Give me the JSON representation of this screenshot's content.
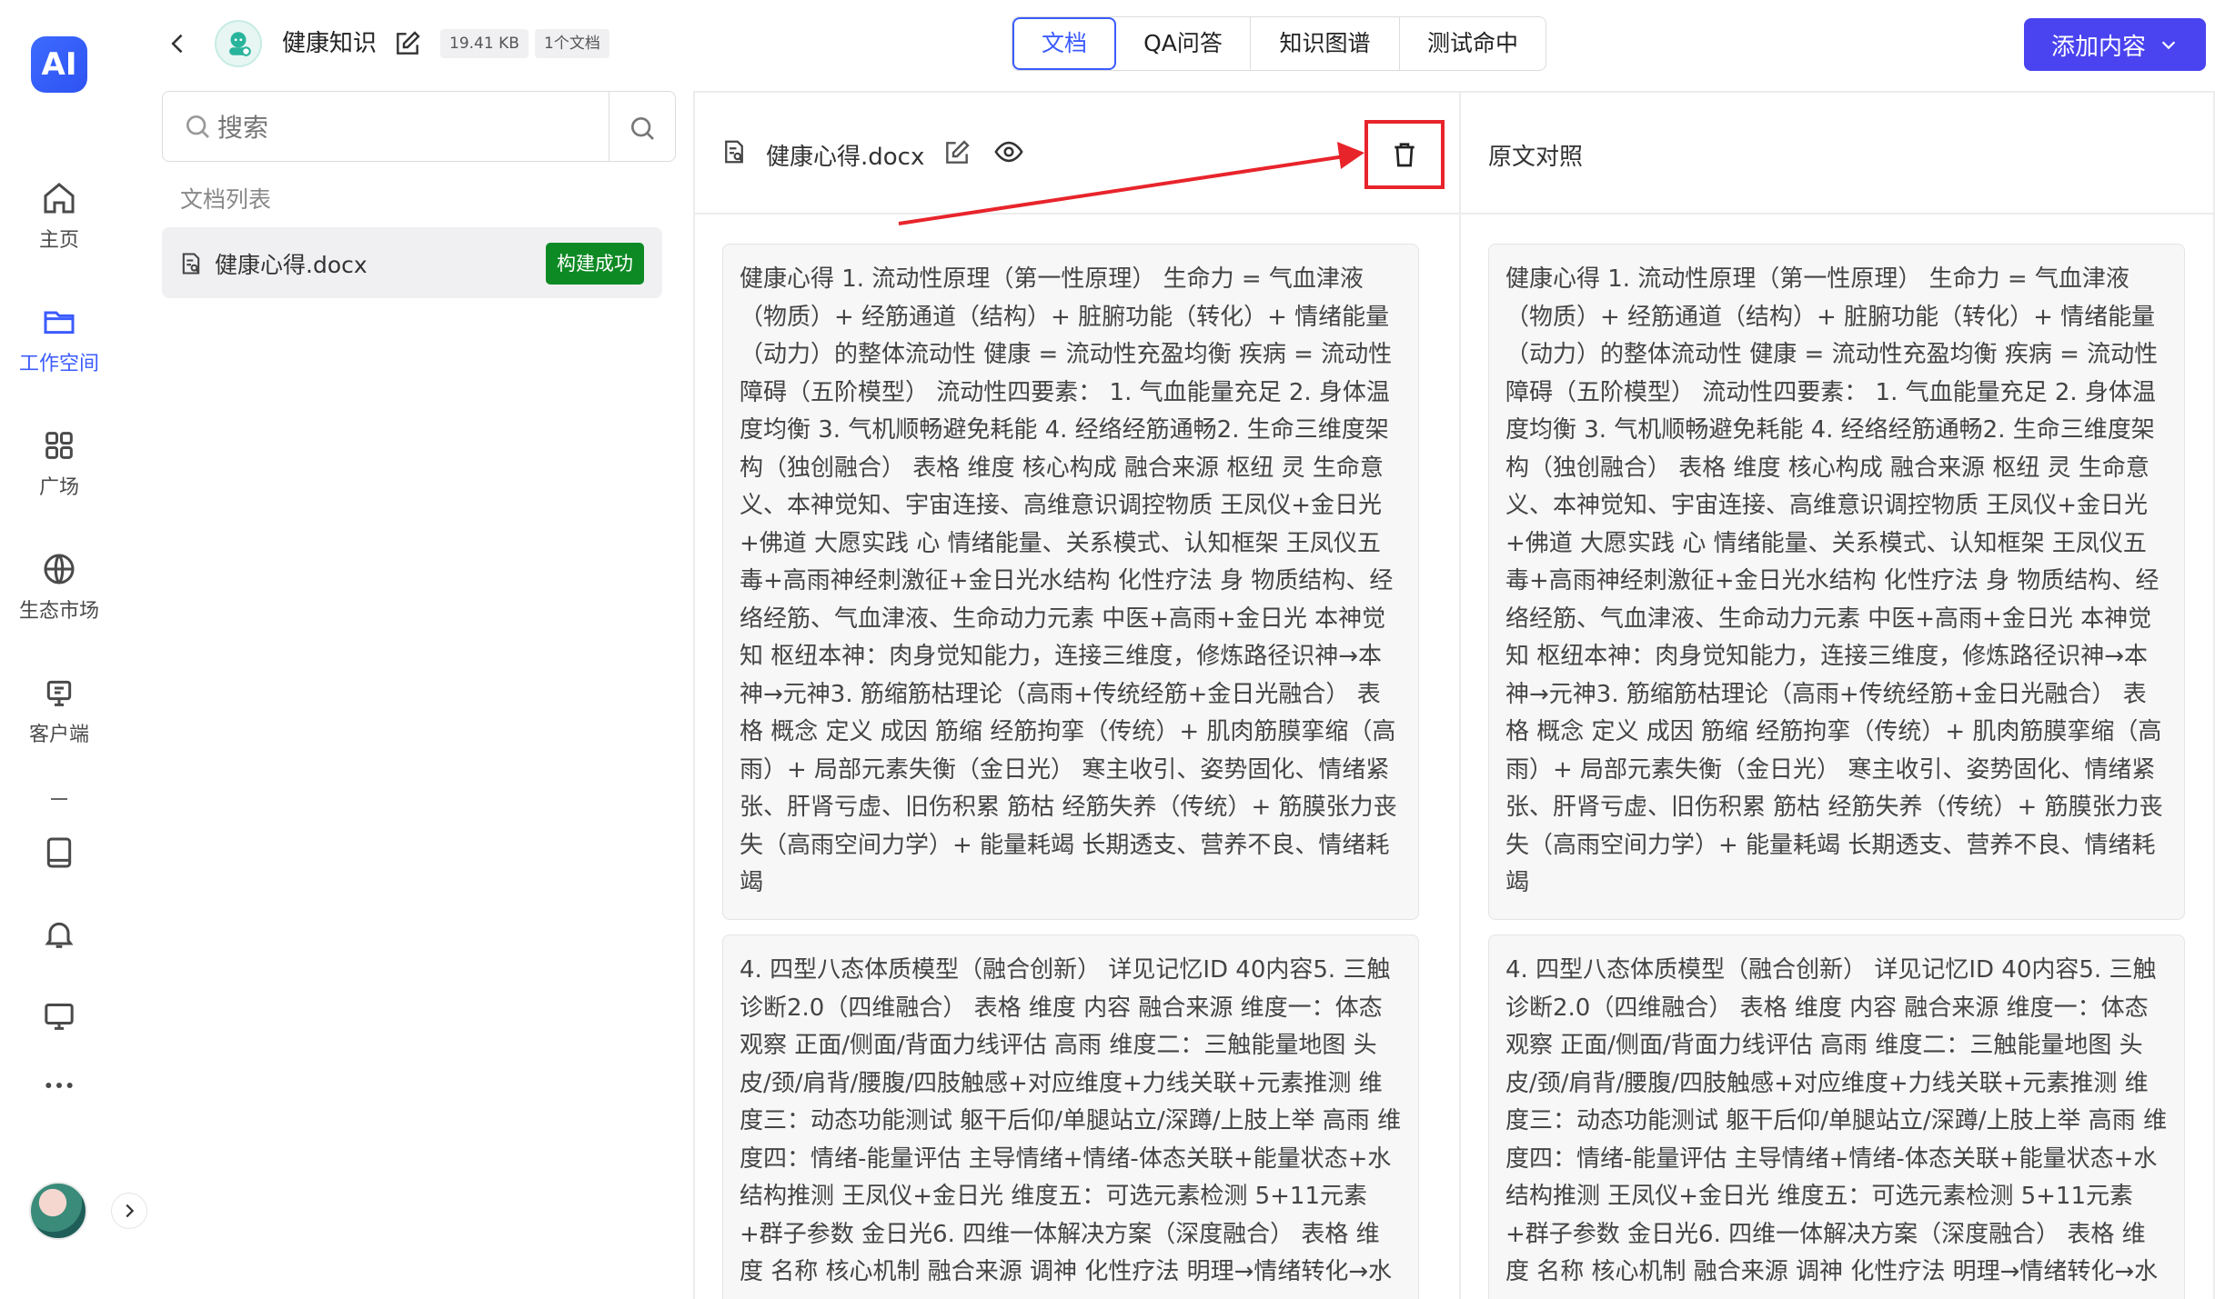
{
  "nav": {
    "logo_text": "AI",
    "items": [
      {
        "label": "主页",
        "icon": "home-icon"
      },
      {
        "label": "工作空间",
        "icon": "folder-icon"
      },
      {
        "label": "广场",
        "icon": "grid-icon"
      },
      {
        "label": "生态市场",
        "icon": "globe-icon"
      },
      {
        "label": "客户端",
        "icon": "client-icon"
      }
    ],
    "extra_icons": [
      "book-icon",
      "bell-icon",
      "monitor-icon",
      "more-icon"
    ]
  },
  "header": {
    "kb_title": "健康知识",
    "size_tag": "19.41 KB",
    "doc_count_tag": "1个文档",
    "tabs": [
      {
        "label": "文档"
      },
      {
        "label": "QA问答"
      },
      {
        "label": "知识图谱"
      },
      {
        "label": "测试命中"
      }
    ],
    "add_button": "添加内容"
  },
  "sidebar": {
    "search_placeholder": "搜索",
    "list_title": "文档列表",
    "docs": [
      {
        "name": "健康心得.docx",
        "status": "构建成功"
      }
    ]
  },
  "main": {
    "doc_name": "健康心得.docx",
    "compare_title": "原文对照",
    "chunks": [
      "健康心得 1. 流动性原理（第一性原理） 生命力 = 气血津液（物质）+ 经筋通道（结构）+ 脏腑功能（转化）+ 情绪能量（动力）的整体流动性 健康 = 流动性充盈均衡 疾病 = 流动性障碍（五阶模型） 流动性四要素： 1. 气血能量充足 2. 身体温度均衡 3. 气机顺畅避免耗能 4. 经络经筋通畅2. 生命三维度架构（独创融合） 表格 维度 核心构成 融合来源 枢纽 灵 生命意义、本神觉知、宇宙连接、高维意识调控物质 王凤仪+金日光+佛道 大愿实践 心 情绪能量、关系模式、认知框架 王凤仪五毒+高雨神经刺激征+金日光水结构 化性疗法 身 物质结构、经络经筋、气血津液、生命动力元素 中医+高雨+金日光 本神觉知 枢纽本神：肉身觉知能力，连接三维度，修炼路径识神→本神→元神3. 筋缩筋枯理论（高雨+传统经筋+金日光融合） 表格 概念 定义 成因 筋缩 经筋拘挛（传统）+ 肌肉筋膜挛缩（高雨）+ 局部元素失衡（金日光） 寒主收引、姿势固化、情绪紧张、肝肾亏虚、旧伤积累 筋枯 经筋失养（传统）+ 筋膜张力丧失（高雨空间力学）+ 能量耗竭 长期透支、营养不良、情绪耗竭",
      "4. 四型八态体质模型（融合创新） 详见记忆ID 40内容5. 三触诊断2.0（四维融合） 表格 维度 内容 融合来源 维度一：体态观察 正面/侧面/背面力线评估 高雨 维度二：三触能量地图 头皮/颈/肩背/腰腹/四肢触感+对应维度+力线关联+元素推测 维度三：动态功能测试 躯干后仰/单腿站立/深蹲/上肢上举 高雨 维度四：情绪-能量评估 主导情绪+情绪-体态关联+能量状态+水结构推测 王凤仪+金日光 维度五：可选元素检测 5+11元素+群子参数 金日光6. 四维一体解决方案（深度融合） 表格 维度 名称 核心机制 融合来源 调神 化性疗法 明理→情绪转化→水"
    ]
  }
}
